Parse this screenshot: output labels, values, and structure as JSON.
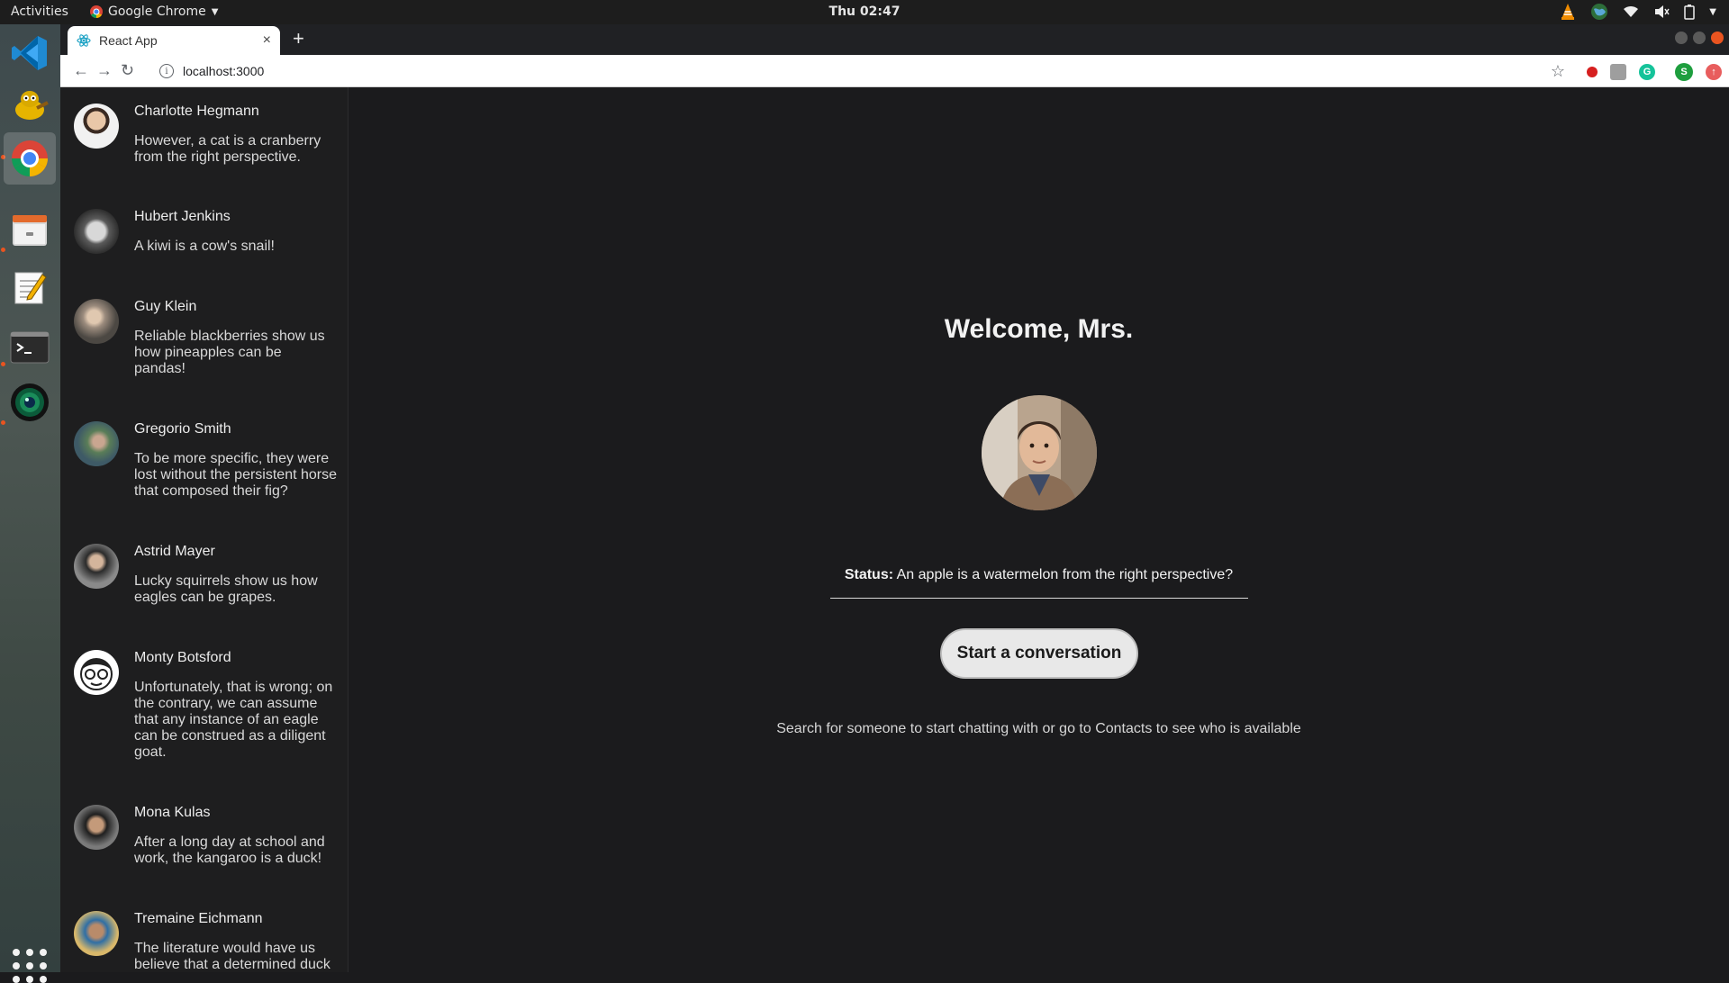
{
  "topbar": {
    "activities": "Activities",
    "app_name": "Google Chrome",
    "clock": "Thu 02:47"
  },
  "dock": {
    "items": [
      "vscode-icon",
      "gimp-icon",
      "chrome-icon",
      "files-icon",
      "text-editor-icon",
      "terminal-icon",
      "camera-app-icon"
    ],
    "show_apps": "show-apps-icon"
  },
  "browser": {
    "tab_title": "React App",
    "tab_close": "×",
    "new_tab": "+",
    "url": "localhost:3000"
  },
  "conversations": [
    {
      "name": "Charlotte Hegmann",
      "message": "However, a cat is a cranberry from the right perspective."
    },
    {
      "name": "Hubert Jenkins",
      "message": "A kiwi is a cow's snail!"
    },
    {
      "name": "Guy Klein",
      "message": "Reliable blackberries show us how pineapples can be pandas!"
    },
    {
      "name": "Gregorio Smith",
      "message": "To be more specific, they were lost without the persistent horse that composed their fig?"
    },
    {
      "name": "Astrid Mayer",
      "message": "Lucky squirrels show us how eagles can be grapes."
    },
    {
      "name": "Monty Botsford",
      "message": "Unfortunately, that is wrong; on the contrary, we can assume that any instance of an eagle can be construed as a diligent goat."
    },
    {
      "name": "Mona Kulas",
      "message": "After a long day at school and work, the kangaroo is a duck!"
    },
    {
      "name": "Tremaine Eichmann",
      "message": "The literature would have us believe that a determined duck"
    }
  ],
  "main": {
    "welcome": "Welcome, Mrs.",
    "status_label": "Status:",
    "status_text": "An apple is a watermelon from the right perspective?",
    "cta": "Start a conversation",
    "hint": "Search for someone to start chatting with or go to Contacts to see who is available"
  }
}
